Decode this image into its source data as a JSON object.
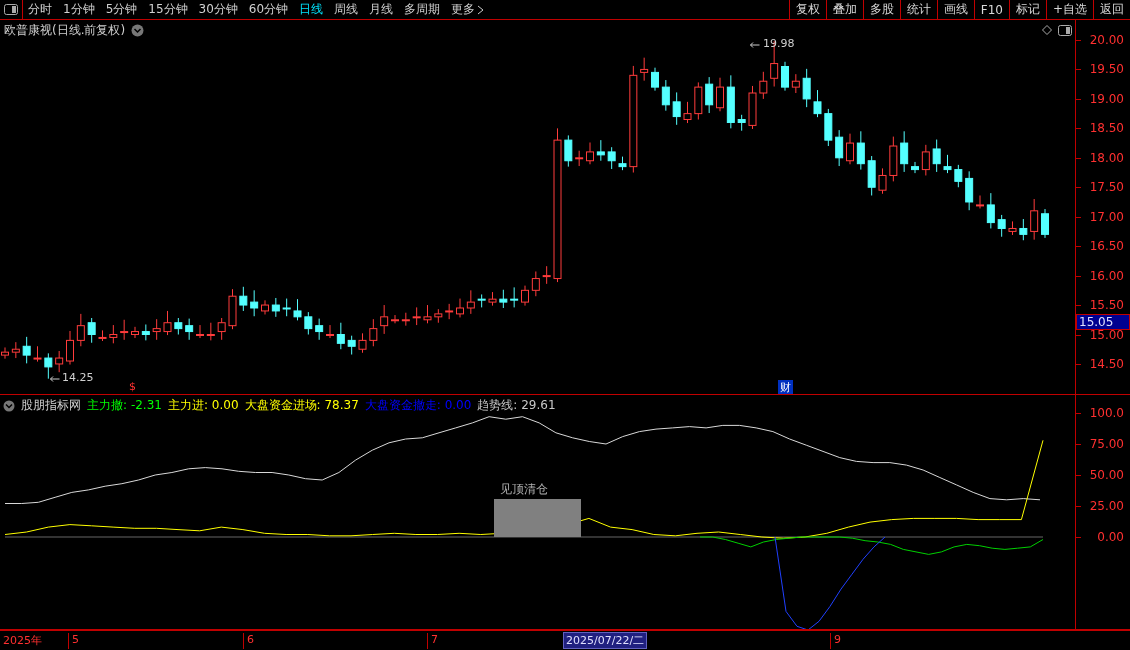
{
  "toolbar": {
    "periods": [
      {
        "label": "分时",
        "selected": false
      },
      {
        "label": "1分钟",
        "selected": false
      },
      {
        "label": "5分钟",
        "selected": false
      },
      {
        "label": "15分钟",
        "selected": false
      },
      {
        "label": "30分钟",
        "selected": false
      },
      {
        "label": "60分钟",
        "selected": false
      },
      {
        "label": "日线",
        "selected": true
      },
      {
        "label": "周线",
        "selected": false
      },
      {
        "label": "月线",
        "selected": false
      },
      {
        "label": "多周期",
        "selected": false
      },
      {
        "label": "更多",
        "selected": false
      }
    ],
    "actions": [
      "复权",
      "叠加",
      "多股",
      "统计",
      "画线",
      "F10",
      "标记",
      "+自选",
      "返回"
    ]
  },
  "price_chart": {
    "title": "欧普康视(日线.前复权)",
    "high_label": "19.98",
    "low_label": "14.25",
    "current_price": "15.05",
    "axis_labels": [
      "20.00",
      "19.50",
      "19.00",
      "18.50",
      "18.00",
      "17.50",
      "17.00",
      "16.50",
      "16.00",
      "15.50",
      "15.00",
      "14.50"
    ],
    "markers": [
      {
        "kind": "dividend",
        "text": "$"
      },
      {
        "kind": "finance",
        "text": "财"
      }
    ]
  },
  "indicator": {
    "name": "股朋指标网",
    "signal_label": "见顶清仓",
    "legend": [
      {
        "label": "主力撤:",
        "value": "-2.31",
        "color": "#00ff00"
      },
      {
        "label": "主力进:",
        "value": "0.00",
        "color": "#ffff00"
      },
      {
        "label": "大盘资金进场:",
        "value": "78.37",
        "color": "#ffff00"
      },
      {
        "label": "大盘资金撤走:",
        "value": "0.00",
        "color": "#0000ff"
      },
      {
        "label": "趋势线:",
        "value": "29.61",
        "color": "#c8c8c8"
      }
    ],
    "axis_labels": [
      "100.0",
      "75.00",
      "50.00",
      "25.00",
      "0.00"
    ]
  },
  "date_axis": {
    "year": "2025年",
    "months": [
      "5",
      "6",
      "7",
      "9"
    ],
    "cursor_date": "2025/07/22/二"
  }
}
